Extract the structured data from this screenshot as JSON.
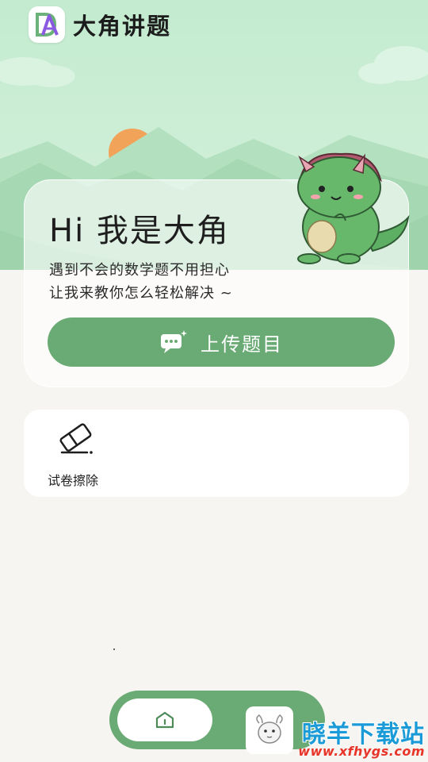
{
  "app": {
    "title": "大角讲题"
  },
  "hero": {
    "heading": "Hi 我是大角",
    "subtitle_line1": "遇到不会的数学题不用担心",
    "subtitle_line2": "让我来教你怎么轻松解决 ~",
    "upload_label": "上传题目"
  },
  "tools": [
    {
      "label": "试卷擦除",
      "icon": "eraser-icon"
    }
  ],
  "bottom_nav": {
    "home_icon": "home-icon",
    "mascot_icon": "sheep-mascot-icon"
  },
  "watermark": {
    "text": "晓羊下载站",
    "url": "www.xfhygs.com"
  },
  "colors": {
    "primary_green": "#6aaa74",
    "hero_bg": "#c3ebcf",
    "page_bg": "#f7f5f1",
    "sun": "#f2a35a",
    "watermark_blue": "#1a9ad6",
    "watermark_red": "#e8352a"
  }
}
